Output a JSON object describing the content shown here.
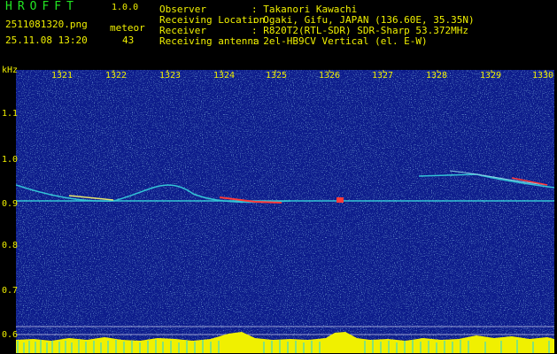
{
  "header": {
    "app_name": "HROFFT",
    "version": "1.0.0",
    "file_name": "2511081320.png",
    "timestamp": "25.11.08 13:20",
    "meteor_label": "meteor",
    "meteor_count": "43"
  },
  "info": [
    {
      "key": "Observer",
      "value": ": Takanori Kawachi"
    },
    {
      "key": "Receiving Location",
      "value": ": Ogaki, Gifu, JAPAN (136.60E, 35.35N)"
    },
    {
      "key": "Receiver",
      "value": ": R820T2(RTL-SDR) SDR-Sharp 53.372MHz"
    },
    {
      "key": "Receiving antenna",
      "value": ": 2el-HB9CV Vertical (el. E-W)"
    }
  ],
  "spectrogram": {
    "y_unit": "kHz",
    "x_ticks": [
      "1321",
      "1322",
      "1323",
      "1324",
      "1325",
      "1326",
      "1327",
      "1328",
      "1329",
      "1330"
    ],
    "y_ticks": [
      "1.1",
      "1.0",
      "0.9",
      "0.8",
      "0.7",
      "0.6"
    ],
    "colors": {
      "background": "#0a1a8c",
      "trace": "#33c4d6",
      "hot": "#ff3a3a",
      "label": "#f0f000",
      "noise_bar": "#f0f000",
      "cyan_bar": "#18d8f0"
    }
  }
}
